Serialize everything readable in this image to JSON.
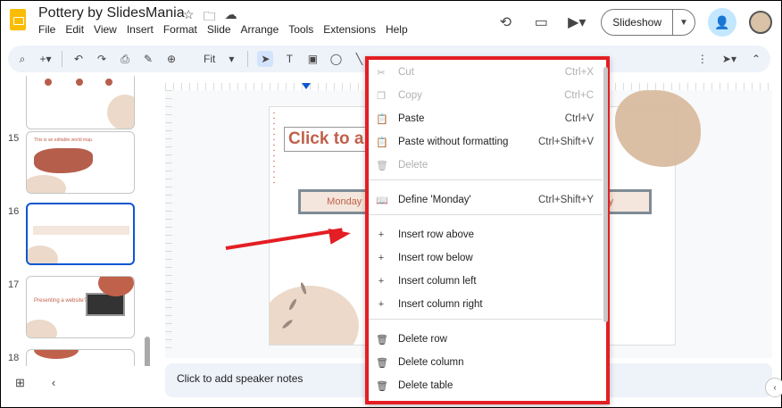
{
  "header": {
    "title": "Pottery by SlidesMania",
    "menu": [
      "File",
      "Edit",
      "View",
      "Insert",
      "Format",
      "Slide",
      "Arrange",
      "Tools",
      "Extensions",
      "Help"
    ],
    "slideshow_label": "Slideshow"
  },
  "toolbar": {
    "zoom_label": "Fit"
  },
  "filmstrip": {
    "slides": [
      {
        "number": "15",
        "text": "This is an editable world map."
      },
      {
        "number": "16",
        "text": ""
      },
      {
        "number": "17",
        "text": "Presenting a website?"
      },
      {
        "number": "18",
        "text": ""
      }
    ]
  },
  "slide": {
    "title": "Click to a",
    "table_cells": [
      "Monday",
      "day"
    ]
  },
  "notes": {
    "placeholder": "Click to add speaker notes"
  },
  "context_menu": {
    "items": [
      {
        "label": "Cut",
        "shortcut": "Ctrl+X",
        "icon": "scissors-icon",
        "glyph": "✂",
        "disabled": true
      },
      {
        "label": "Copy",
        "shortcut": "Ctrl+C",
        "icon": "copy-icon",
        "glyph": "❐",
        "disabled": true
      },
      {
        "label": "Paste",
        "shortcut": "Ctrl+V",
        "icon": "clipboard-icon",
        "glyph": "📋",
        "disabled": false
      },
      {
        "label": "Paste without formatting",
        "shortcut": "Ctrl+Shift+V",
        "icon": "paste-plain-icon",
        "glyph": "📋",
        "disabled": false
      },
      {
        "label": "Delete",
        "shortcut": "",
        "icon": "trash-icon",
        "glyph": "🗑",
        "disabled": true
      },
      {
        "label": "Define 'Monday'",
        "shortcut": "Ctrl+Shift+Y",
        "icon": "book-icon",
        "glyph": "📖",
        "disabled": false
      },
      {
        "label": "Insert row above",
        "shortcut": "",
        "icon": "plus-icon",
        "glyph": "+",
        "disabled": false
      },
      {
        "label": "Insert row below",
        "shortcut": "",
        "icon": "plus-icon",
        "glyph": "+",
        "disabled": false
      },
      {
        "label": "Insert column left",
        "shortcut": "",
        "icon": "plus-icon",
        "glyph": "+",
        "disabled": false
      },
      {
        "label": "Insert column right",
        "shortcut": "",
        "icon": "plus-icon",
        "glyph": "+",
        "disabled": false
      },
      {
        "label": "Delete row",
        "shortcut": "",
        "icon": "trash-icon",
        "glyph": "🗑",
        "disabled": false
      },
      {
        "label": "Delete column",
        "shortcut": "",
        "icon": "trash-icon",
        "glyph": "🗑",
        "disabled": false
      },
      {
        "label": "Delete table",
        "shortcut": "",
        "icon": "trash-icon",
        "glyph": "🗑",
        "disabled": false
      }
    ]
  },
  "colors": {
    "highlight_border": "#e31e24",
    "accent": "#0b57d0",
    "brand_text": "#c0614b"
  }
}
